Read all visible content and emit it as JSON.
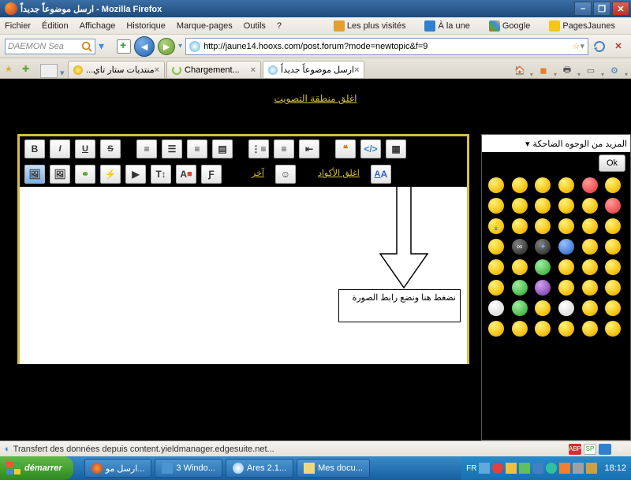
{
  "window": {
    "title": "ارسل موضوعاً جديداً - Mozilla Firefox"
  },
  "menu": {
    "items": [
      "Fichier",
      "Édition",
      "Affichage",
      "Historique",
      "Marque-pages",
      "Outils",
      "?"
    ]
  },
  "bookmarks": [
    {
      "label": "Les plus visités"
    },
    {
      "label": "À la une"
    },
    {
      "label": "Google"
    },
    {
      "label": "PagesJaunes"
    }
  ],
  "search": {
    "placeholder": "DAEMON Sea"
  },
  "url": {
    "value": "http://jaune14.hooxs.com/post.forum?mode=newtopic&f=9"
  },
  "tabs": [
    {
      "label": "...منتديات ستار تاي",
      "active": false
    },
    {
      "label": "Chargement...",
      "active": false
    },
    {
      "label": "ارسل موضوعاً جديداً",
      "active": true
    }
  ],
  "page": {
    "close_vote_link": "اغلق منطقة التصويت",
    "editor_links": {
      "codes": "اغلق الأكواد",
      "other": "آخر"
    },
    "callout": "نضغط هنا ونضع  رابط الصورة",
    "emoji_header": "المزيد من الوجوه الضاحكة",
    "ok": "Ok",
    "toolbar_b": "B",
    "toolbar_i": "I",
    "toolbar_u": "U",
    "toolbar_s": "S",
    "toolbar_aa": "A"
  },
  "status": {
    "text": "Transfert des données depuis content.yieldmanager.edgesuite.net...",
    "abp": "ABP",
    "sp": "SP"
  },
  "taskbar": {
    "start": "démarrer",
    "items": [
      "ارسل مو...",
      "3 Windo...",
      "Ares 2.1...",
      "Mes docu..."
    ],
    "lang": "FR",
    "clock": "18:12"
  }
}
